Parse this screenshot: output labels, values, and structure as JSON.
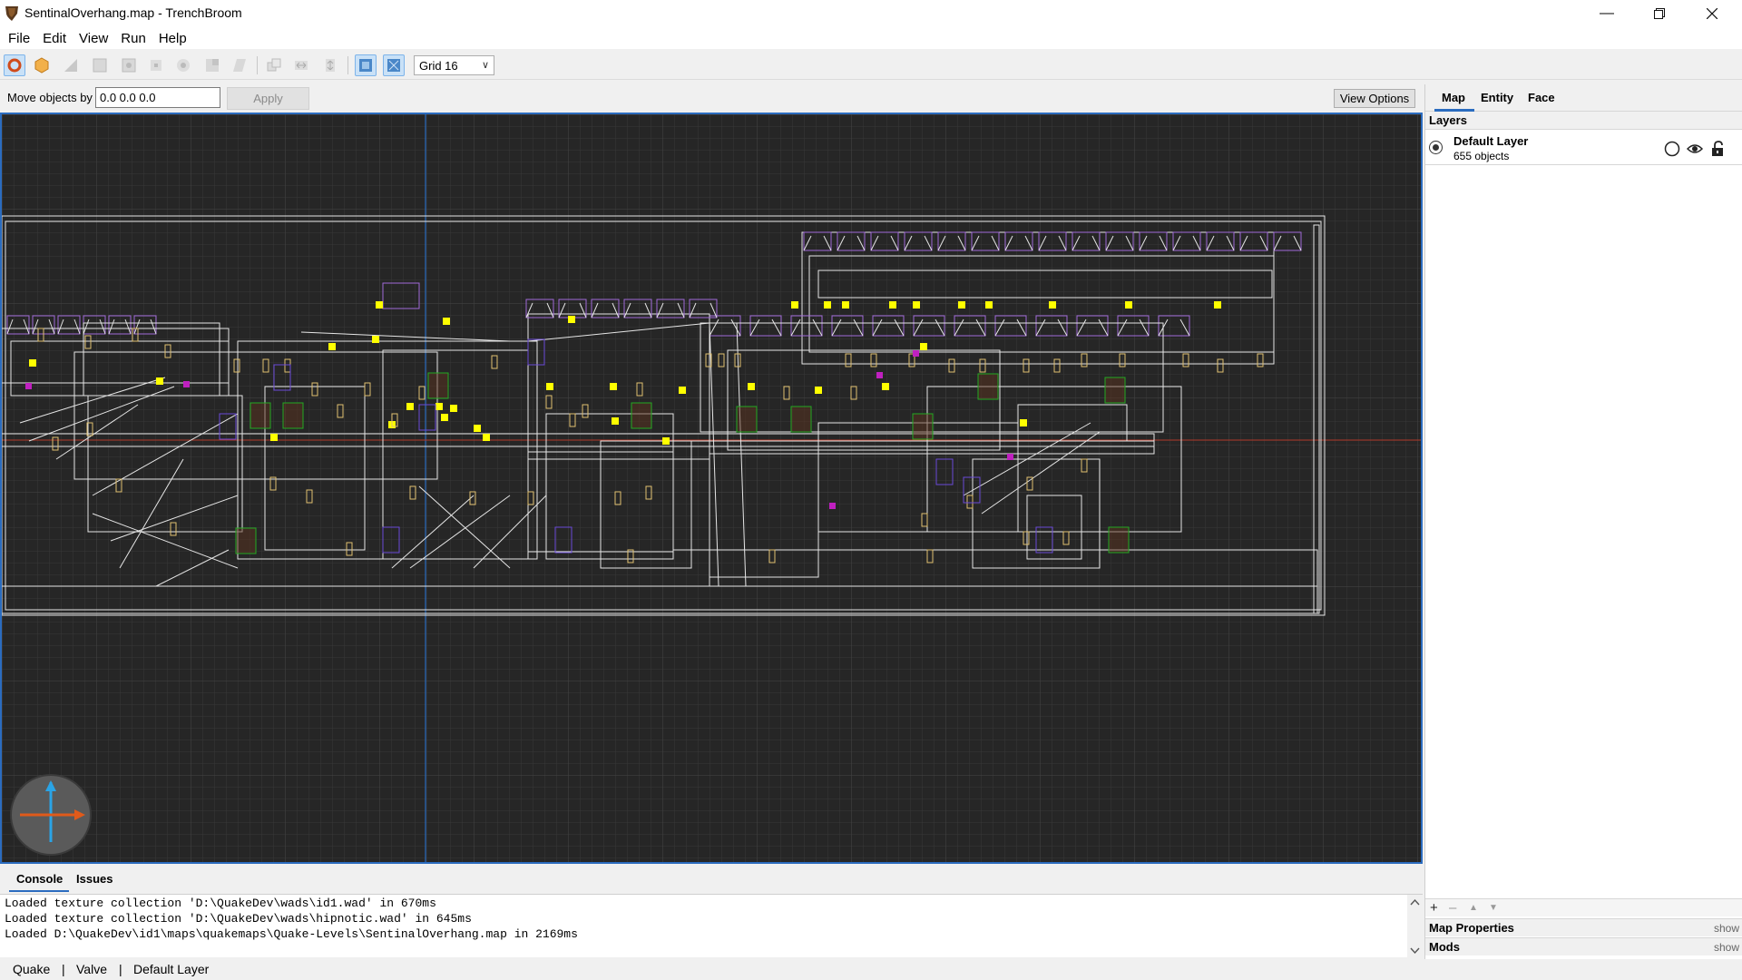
{
  "window": {
    "title": "SentinalOverhang.map - TrenchBroom",
    "minimize_icon": "minimize-icon",
    "maximize_icon": "restore-icon",
    "close_icon": "close-icon"
  },
  "menu": [
    "File",
    "Edit",
    "View",
    "Run",
    "Help"
  ],
  "toolbar": {
    "grid_value": "Grid 16"
  },
  "move_bar": {
    "label": "Move objects by",
    "value": "0.0 0.0 0.0",
    "apply_label": "Apply",
    "view_options_label": "View Options"
  },
  "right_panel": {
    "tabs": [
      "Map",
      "Entity",
      "Face"
    ],
    "active_tab": "Map",
    "layers_title": "Layers",
    "layer": {
      "name": "Default Layer",
      "count": "655 objects"
    },
    "sections": [
      {
        "title": "Map Properties",
        "toggle": "show"
      },
      {
        "title": "Mods",
        "toggle": "show"
      }
    ]
  },
  "console": {
    "tabs": [
      "Console",
      "Issues"
    ],
    "lines": [
      "Loaded texture collection 'D:\\QuakeDev\\wads\\id1.wad' in 670ms",
      "Loaded texture collection 'D:\\QuakeDev\\wads\\hipnotic.wad' in 645ms",
      "Loaded D:\\QuakeDev\\id1\\maps\\quakemaps\\Quake-Levels\\SentinalOverhang.map in 2169ms"
    ]
  },
  "status_bar": [
    "Quake",
    "|",
    "Valve",
    "|",
    "Default Layer"
  ],
  "colors": {
    "viewport_bg": "#262626",
    "accent": "#2b6cbf",
    "brush_line": "#e8e8e8",
    "light_entity": "#ffff00",
    "item_entity": "#8a2be2",
    "monster_box": "#22aa22"
  }
}
